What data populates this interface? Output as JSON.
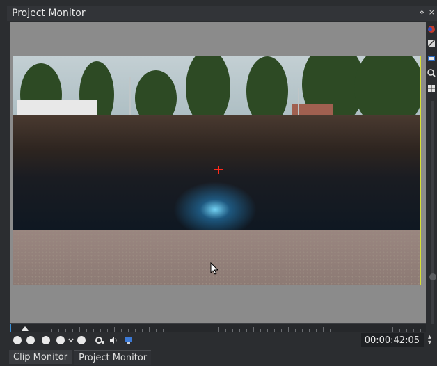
{
  "panel": {
    "title_underlined": "P",
    "title_rest": "roject Monitor",
    "float_glyph": "⋄",
    "close_glyph": "×"
  },
  "timecode": "00:00:42:05",
  "tabs": [
    {
      "label": "Clip Monitor",
      "active": false
    },
    {
      "label": "Project Monitor",
      "active": true
    }
  ],
  "colors": {
    "accent": "#d8e032",
    "playhead": "#3a8fd6",
    "monitor_bg": "#8b8b8b"
  },
  "icons": {
    "transport": [
      "rewind-icon",
      "prev-icon",
      "pause-icon",
      "play-icon",
      "chevron-down-icon",
      "forward-icon"
    ],
    "right_tools": [
      "color-icon",
      "split-view-icon",
      "overlay-icon",
      "zoom-icon",
      "guides-icon"
    ]
  }
}
